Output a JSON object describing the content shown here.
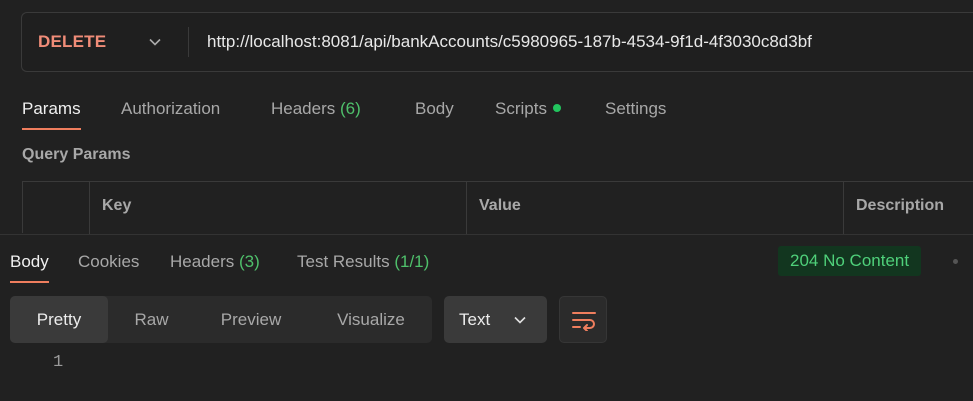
{
  "request": {
    "method": "DELETE",
    "url": "http://localhost:8081/api/bankAccounts/c5980965-187b-4534-9f1d-4f3030c8d3bf",
    "tabs": [
      {
        "label": "Params"
      },
      {
        "label": "Authorization"
      },
      {
        "label": "Headers",
        "count": "(6)"
      },
      {
        "label": "Body"
      },
      {
        "label": "Scripts"
      },
      {
        "label": "Settings"
      }
    ],
    "active_tab": "Params",
    "section_title": "Query Params",
    "table_headers": [
      "",
      "Key",
      "Value",
      "Description"
    ]
  },
  "response": {
    "tabs": [
      {
        "label": "Body"
      },
      {
        "label": "Cookies"
      },
      {
        "label": "Headers",
        "count": "(3)"
      },
      {
        "label": "Test Results",
        "count": "(1/1)"
      }
    ],
    "active_tab": "Body",
    "status": "204 No Content",
    "status_color": "#4fd07a",
    "view_modes": [
      "Pretty",
      "Raw",
      "Preview",
      "Visualize"
    ],
    "active_view_mode": "Pretty",
    "format": "Text",
    "line_numbers": [
      "1"
    ]
  },
  "colors": {
    "method": "#f08c78",
    "accent": "#ef7e5e",
    "count": "#4fc06b",
    "script_dot": "#22c55e"
  }
}
